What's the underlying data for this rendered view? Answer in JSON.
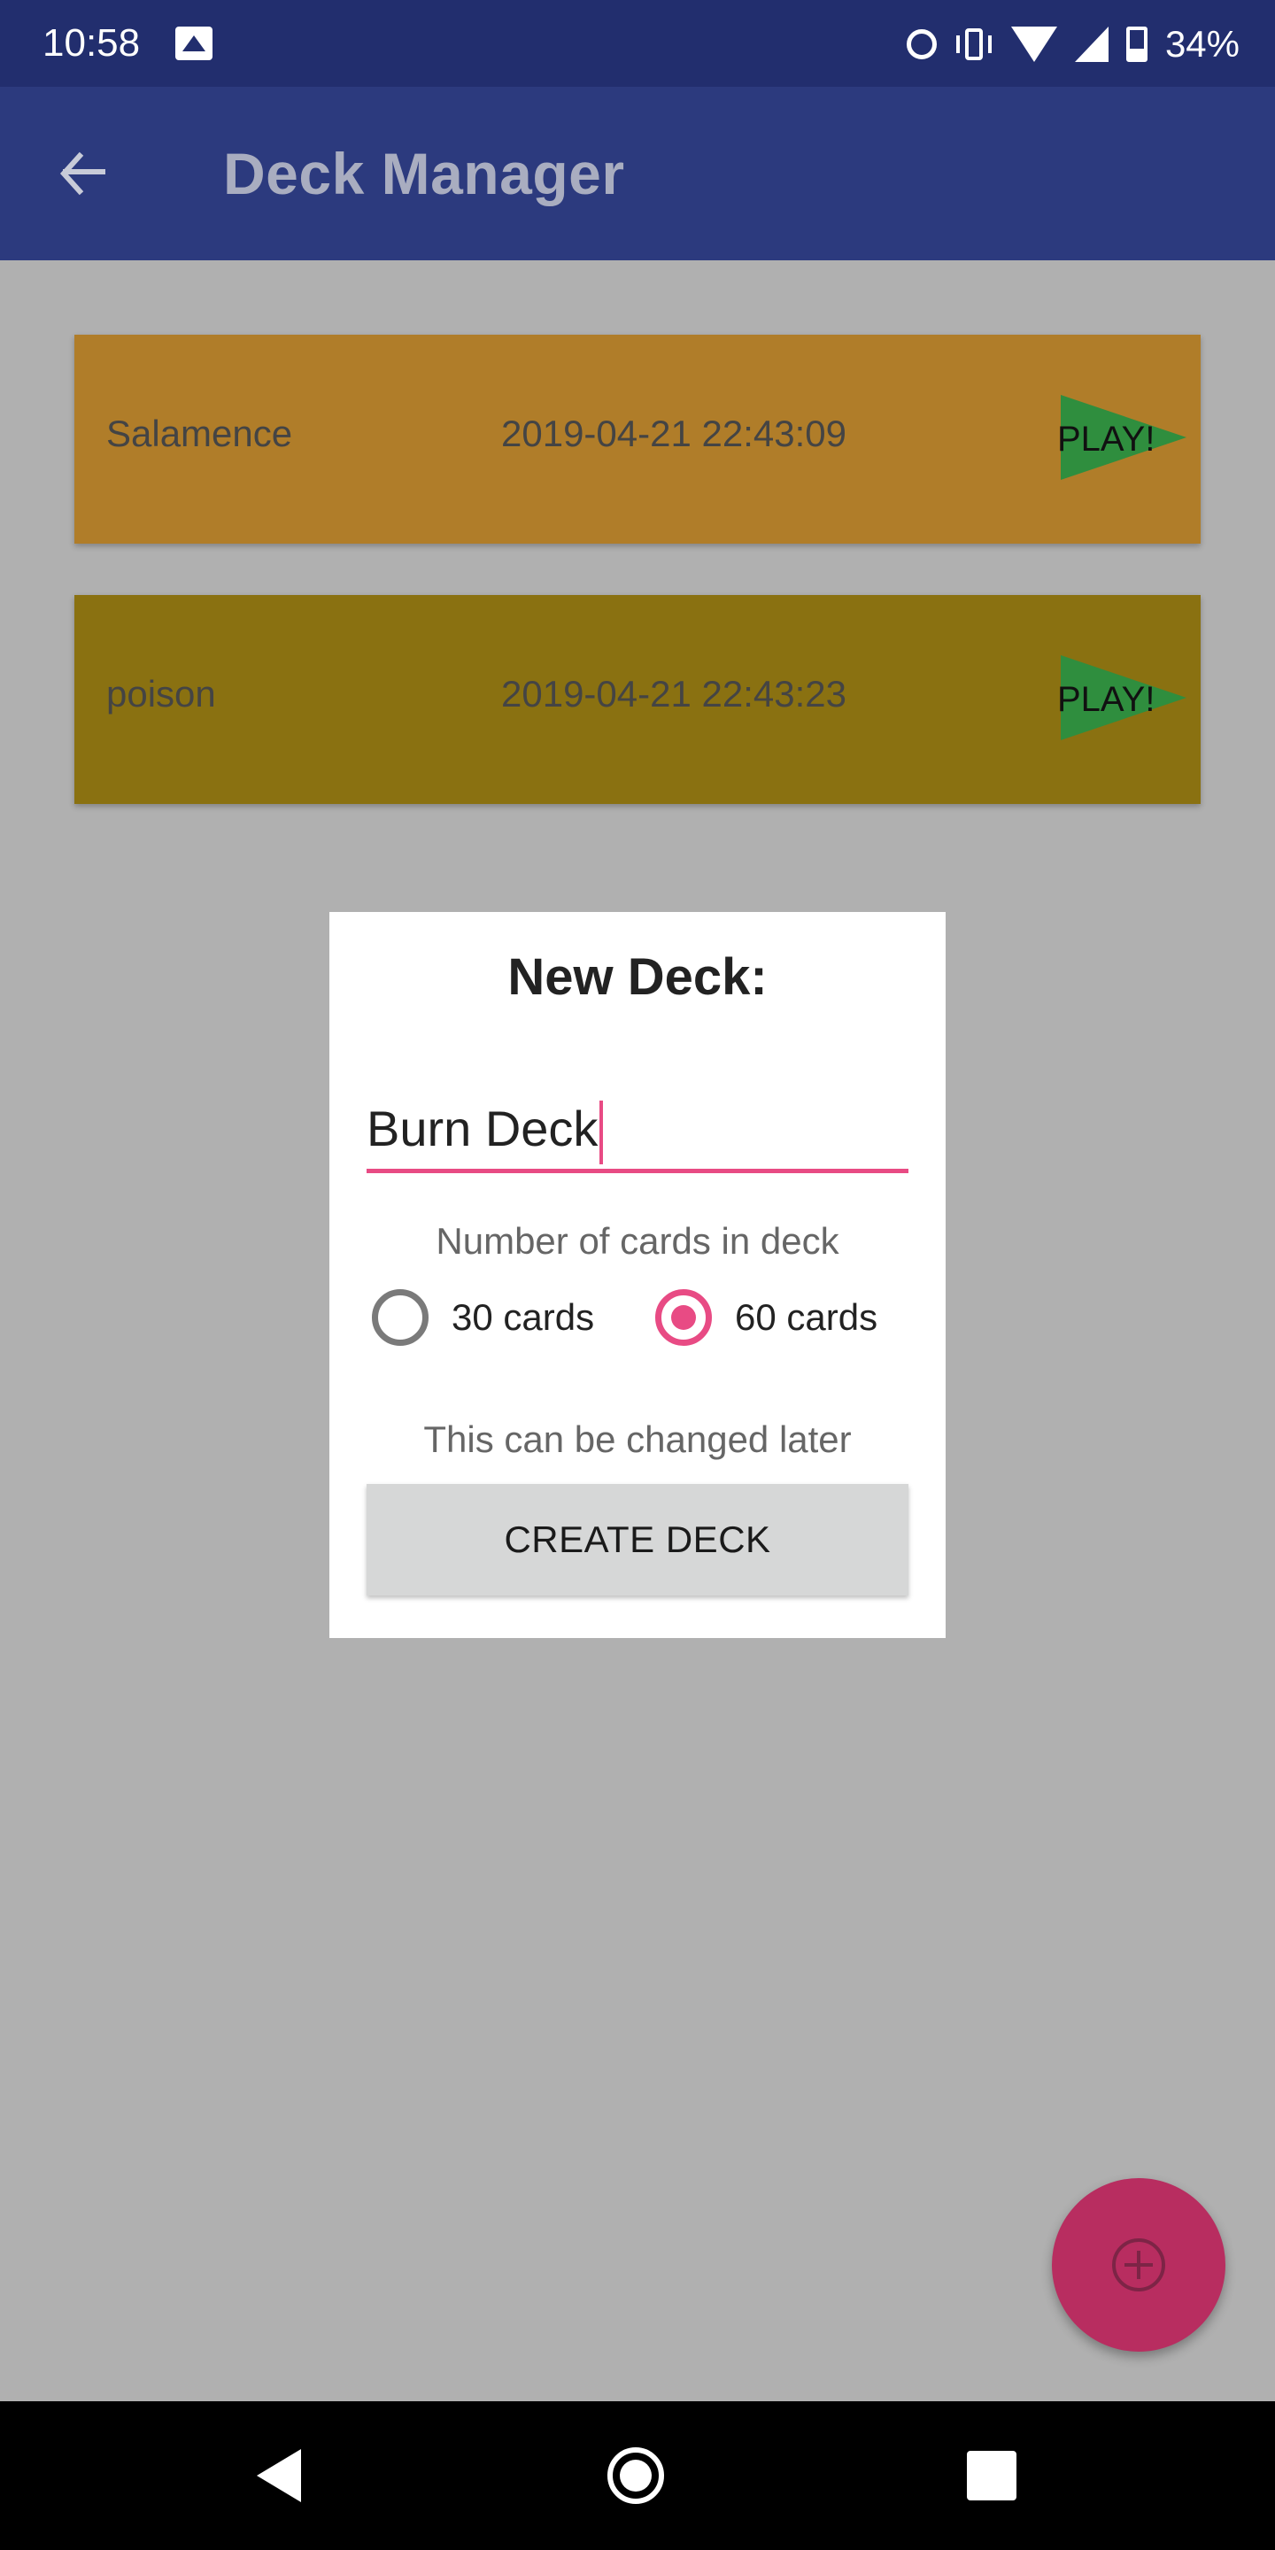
{
  "status_bar": {
    "time": "10:58",
    "battery_text": "34%"
  },
  "app_bar": {
    "title": "Deck Manager"
  },
  "decks": [
    {
      "name": "Salamence",
      "date": "2019-04-21 22:43:09",
      "play_label": "PLAY!",
      "color": "#b07d29"
    },
    {
      "name": "poison",
      "date": "2019-04-21 22:43:23",
      "play_label": "PLAY!",
      "color": "#8a7111"
    }
  ],
  "dialog": {
    "title": "New Deck:",
    "deck_name_value": "Burn Deck",
    "cards_label": "Number of cards in deck",
    "options": [
      {
        "label": "30 cards",
        "selected": false
      },
      {
        "label": "60 cards",
        "selected": true
      }
    ],
    "note": "This can be changed later",
    "create_button": "CREATE DECK"
  },
  "colors": {
    "accent": "#e84b84",
    "fab": "#b82d60",
    "play": "#2f8e3e",
    "app_bar": "#2c3a7e",
    "status_bar": "#222e6e"
  },
  "icons": {
    "back": "arrow-left-icon",
    "fab": "add-circle-icon"
  }
}
